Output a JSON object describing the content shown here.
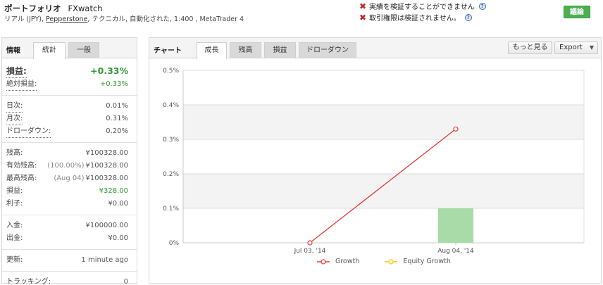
{
  "header": {
    "title": "ポートフォリオ",
    "account": "FXwatch",
    "sub_prefix": "リアル (JPY), ",
    "broker": "Pepperstone",
    "sub_suffix": ", テクニカル, 自動化された, 1:400 , MetaTrader 4",
    "warning1": "実績を検証することができません",
    "warning2": "取引権限は検証されません。",
    "follow_button": "議論"
  },
  "left_panel": {
    "title": "情報",
    "tabs": [
      "統計",
      "一般"
    ],
    "gain_label": "損益:",
    "gain_value": "+0.33%",
    "abs_gain_label": "絶対損益:",
    "abs_gain_value": "+0.33%",
    "daily_label": "日次:",
    "daily_value": "0.01%",
    "monthly_label": "月次:",
    "monthly_value": "0.31%",
    "drawdown_label": "ドローダウン:",
    "drawdown_value": "0.20%",
    "balance_label": "残高:",
    "balance_value": "¥100328.00",
    "equity_label": "有効残高:",
    "equity_pct": "(100.00%)",
    "equity_value": "¥100328.00",
    "highest_label": "最高残高:",
    "highest_date": "(Aug 04)",
    "highest_value": "¥100328.00",
    "profit_label": "損益:",
    "profit_value": "¥328.00",
    "interest_label": "利子:",
    "interest_value": "¥0.00",
    "deposits_label": "入金:",
    "deposits_value": "¥100000.00",
    "withdrawals_label": "出金:",
    "withdrawals_value": "¥0.00",
    "updated_label": "更新:",
    "updated_value": "1 minute ago",
    "tracking_label": "トラッキング:",
    "tracking_value": "0"
  },
  "right_panel": {
    "title": "チャート",
    "tabs": [
      "成長",
      "残高",
      "損益",
      "ドローダウン"
    ],
    "more_button": "もっと見る",
    "export_button": "Export"
  },
  "chart_data": {
    "type": "line",
    "categories": [
      "Jul 03, '14",
      "Aug 04, '14"
    ],
    "series": [
      {
        "name": "Growth",
        "type": "line",
        "values": [
          0,
          0.33
        ],
        "color": "#e53935"
      },
      {
        "name": "Equity Growth",
        "type": "line",
        "values": [],
        "color": "#f2c300"
      },
      {
        "name": "",
        "type": "bar",
        "values": [
          null,
          0.1
        ],
        "color": "#a8dba8"
      }
    ],
    "yticks": [
      "0%",
      "0.1%",
      "0.2%",
      "0.3%",
      "0.4%",
      "0.5%"
    ],
    "ylim": [
      0,
      0.5
    ],
    "grid": true,
    "legend": "bottom"
  }
}
